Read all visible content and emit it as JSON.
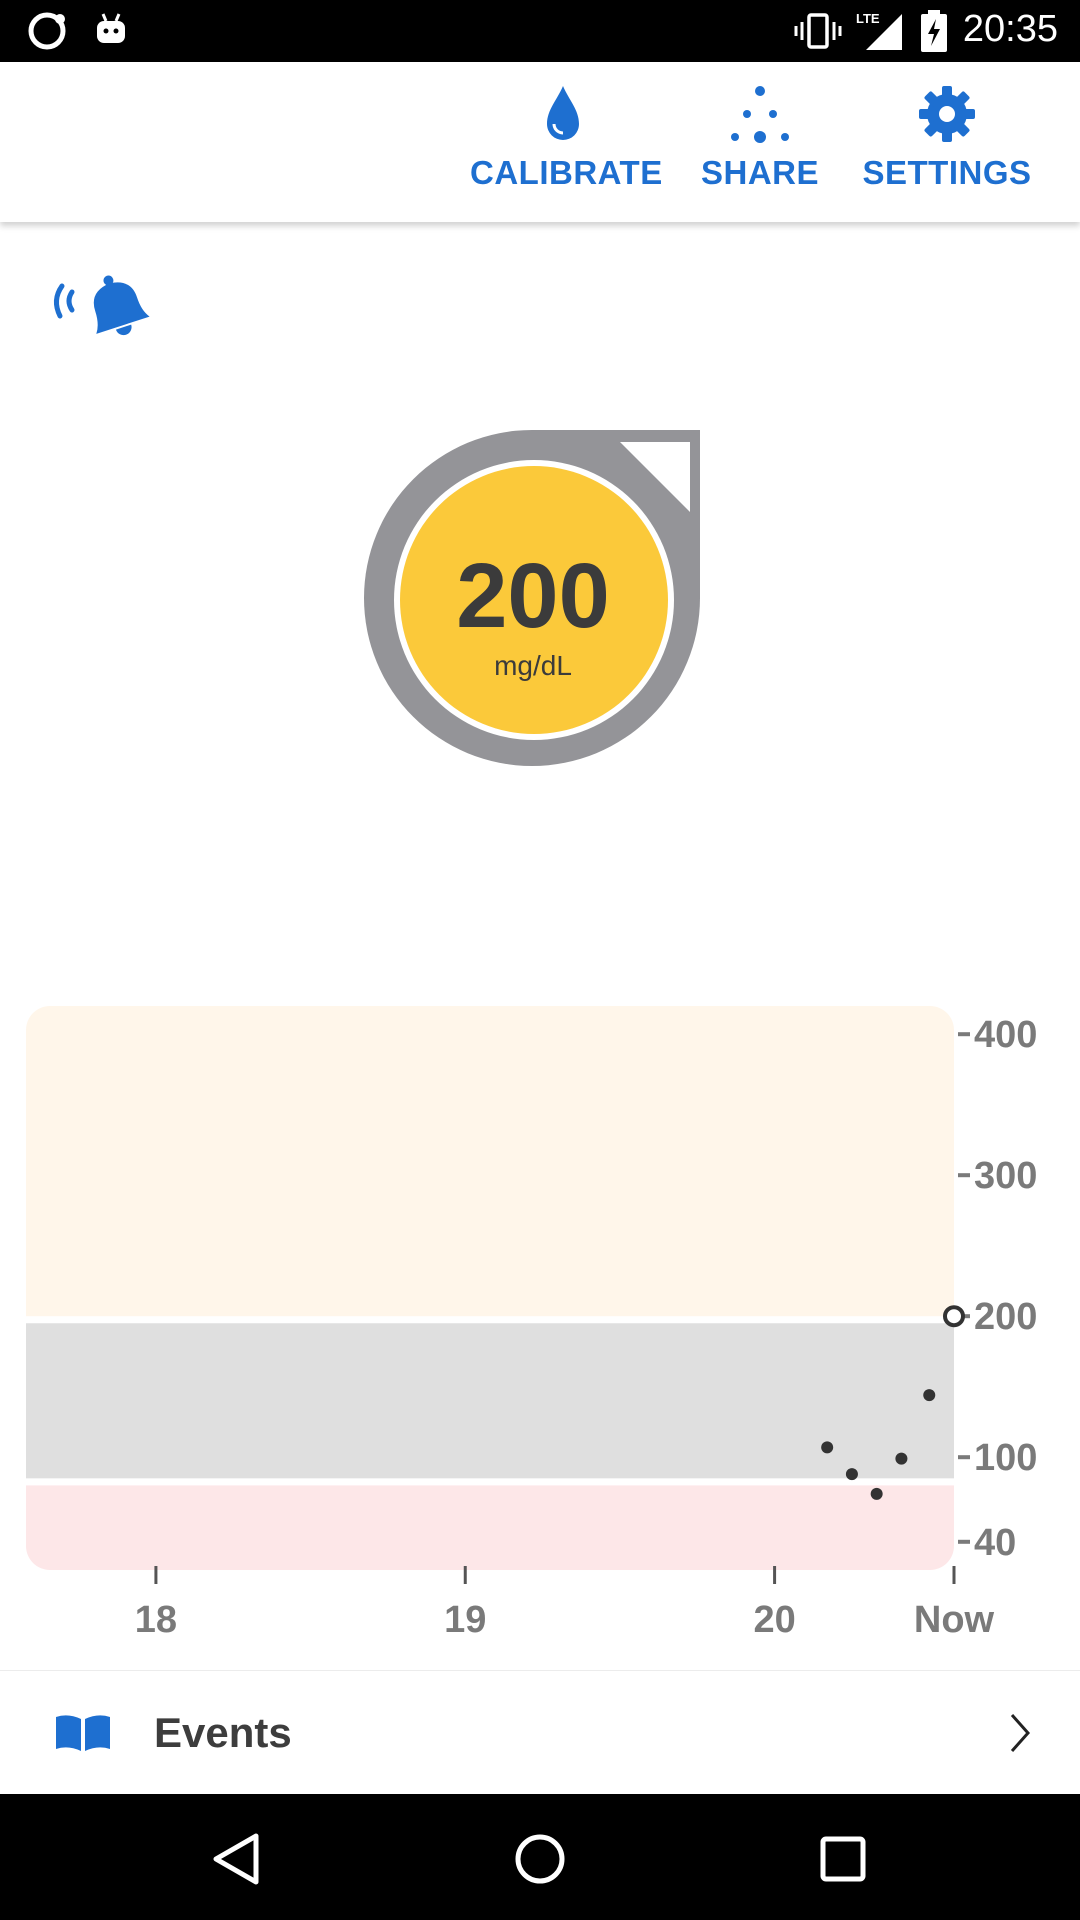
{
  "status_bar": {
    "time": "20:35",
    "icons": [
      "notification-ring-icon",
      "android-icon",
      "vibrate-icon",
      "lte-signal-icon",
      "battery-charging-icon"
    ]
  },
  "toolbar": {
    "calibrate_label": "CALIBRATE",
    "share_label": "SHARE",
    "settings_label": "SETTINGS",
    "icons": [
      "water-drop-icon",
      "share-dots-icon",
      "gear-icon"
    ],
    "accent_color": "#1e6fd0"
  },
  "alert": {
    "icon": "bell-sound-icon"
  },
  "reading": {
    "value": "200",
    "unit": "mg/dL",
    "ring_color": "#949498",
    "fill_color": "#fbc93a"
  },
  "chart_data": {
    "type": "scatter",
    "x_ticks": [
      "18",
      "19",
      "20",
      "Now"
    ],
    "x_tick_values": [
      18,
      19,
      20,
      20.58
    ],
    "y_ticks": [
      "400",
      "300",
      "200",
      "100",
      "40"
    ],
    "y_tick_values": [
      400,
      300,
      200,
      100,
      40
    ],
    "xlim": [
      17.58,
      20.58
    ],
    "ylim": [
      20,
      420
    ],
    "bands": [
      {
        "name": "high",
        "from": 200,
        "to": 420,
        "color": "#fff6ea"
      },
      {
        "name": "target",
        "from": 85,
        "to": 195,
        "color": "#dfdfdf"
      },
      {
        "name": "low",
        "from": 20,
        "to": 80,
        "color": "#fde7e8"
      }
    ],
    "points": [
      {
        "x": 20.17,
        "y": 107
      },
      {
        "x": 20.25,
        "y": 88
      },
      {
        "x": 20.33,
        "y": 74
      },
      {
        "x": 20.41,
        "y": 99
      },
      {
        "x": 20.5,
        "y": 144
      }
    ],
    "current_point": {
      "x": 20.58,
      "y": 200
    },
    "grid": false
  },
  "events": {
    "label": "Events",
    "icon": "book-icon",
    "chevron": "chevron-right-icon"
  },
  "nav_bar": {
    "icons": [
      "back-icon",
      "home-icon",
      "recents-icon"
    ]
  }
}
